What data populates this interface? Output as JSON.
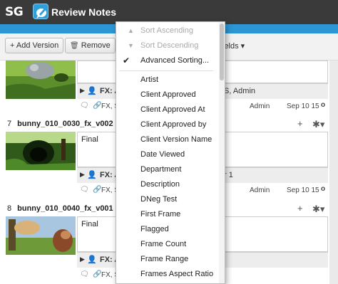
{
  "app": {
    "logo": "SG",
    "title": "Review Notes",
    "icon": "review-notes-icon"
  },
  "toolbar": {
    "add_version": "+ Add Version",
    "remove": "Remove",
    "fields": "ields ▾"
  },
  "rows": [
    {
      "num": "",
      "name": "",
      "note": "",
      "fx_author": "FX: A",
      "fx_right": "S, Admin",
      "meta_mid": "FX, S",
      "meta_user": "Admin",
      "meta_date": "Sep 10 15",
      "meta_dot": "o"
    },
    {
      "num": "7",
      "name": "bunny_010_0030_fx_v002",
      "note": "Final",
      "fx_author": "FX: A",
      "fx_right": "r 1",
      "meta_mid": "FX, S",
      "meta_user": "Admin",
      "meta_date": "Sep 10 15",
      "meta_dot": "o"
    },
    {
      "num": "8",
      "name": "bunny_010_0040_fx_v001",
      "note": "Final",
      "fx_author": "FX: A",
      "fx_right": "",
      "meta_mid": "FX, S",
      "meta_user": "",
      "meta_date": "",
      "meta_dot": ""
    }
  ],
  "row_actions": {
    "plus": "+",
    "gear": "✱▾"
  },
  "menu": {
    "sort_asc": "Sort Ascending",
    "sort_desc": "Sort Descending",
    "advanced": "Advanced Sorting...",
    "check": "✔",
    "up": "▲",
    "down": "▼",
    "fields": [
      "Artist",
      "Client Approved",
      "Client Approved At",
      "Client Approved by",
      "Client Version Name",
      "Date Viewed",
      "Department",
      "Description",
      "DNeg Test",
      "First Frame",
      "Flagged",
      "Frame Count",
      "Frame Range",
      "Frames Aspect Ratio"
    ]
  },
  "colors": {
    "titlebar": "#3a3a3a",
    "accent": "#2c97d4"
  }
}
